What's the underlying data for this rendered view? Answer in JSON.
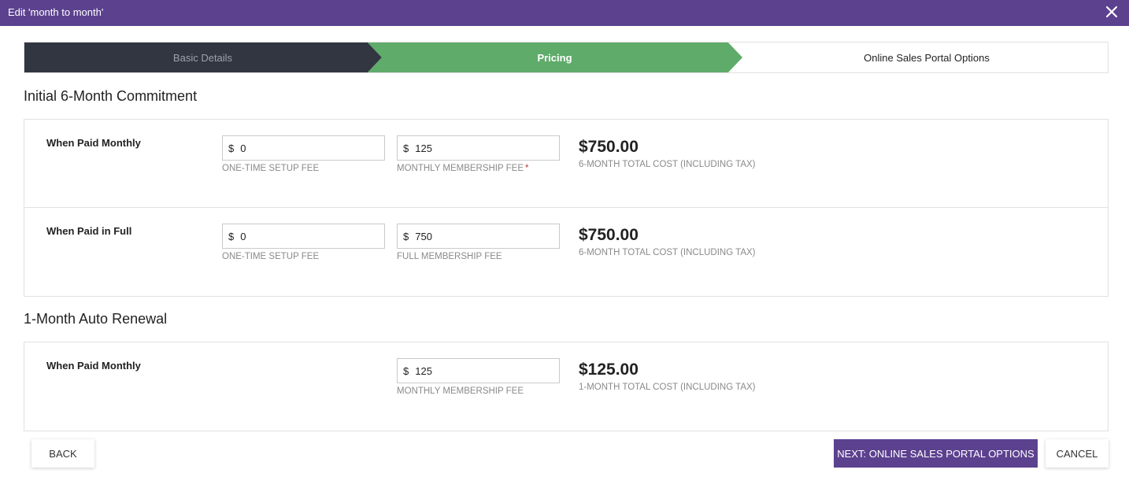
{
  "dialog": {
    "title": "Edit 'month to month'",
    "close_icon": "close-icon"
  },
  "steps": [
    {
      "label": "Basic Details",
      "state": "done"
    },
    {
      "label": "Pricing",
      "state": "active"
    },
    {
      "label": "Online Sales Portal Options",
      "state": "upcoming"
    }
  ],
  "initial": {
    "heading": "Initial 6-Month Commitment",
    "monthly": {
      "label": "When Paid Monthly",
      "setup_currency": "$",
      "setup_value": "0",
      "setup_caption": "ONE-TIME SETUP FEE",
      "fee_currency": "$",
      "fee_value": "125",
      "fee_caption": "MONTHLY MEMBERSHIP FEE",
      "fee_required_mark": "*",
      "total": "$750.00",
      "total_caption": "6-MONTH TOTAL COST (INCLUDING TAX)"
    },
    "full": {
      "label": "When Paid in Full",
      "setup_currency": "$",
      "setup_value": "0",
      "setup_caption": "ONE-TIME SETUP FEE",
      "fee_currency": "$",
      "fee_value": "750",
      "fee_caption": "FULL MEMBERSHIP FEE",
      "total": "$750.00",
      "total_caption": "6-MONTH TOTAL COST (INCLUDING TAX)"
    }
  },
  "renewal": {
    "heading": "1-Month Auto Renewal",
    "monthly": {
      "label": "When Paid Monthly",
      "fee_currency": "$",
      "fee_value": "125",
      "fee_caption": "MONTHLY MEMBERSHIP FEE",
      "total": "$125.00",
      "total_caption": "1-MONTH TOTAL COST (INCLUDING TAX)"
    }
  },
  "footer": {
    "back_label": "BACK",
    "next_label": "NEXT: ONLINE SALES PORTAL OPTIONS",
    "cancel_label": "CANCEL"
  },
  "colors": {
    "header": "#5c418f",
    "step_done": "#323641",
    "step_active": "#5fab6a",
    "required": "#c0392b"
  }
}
